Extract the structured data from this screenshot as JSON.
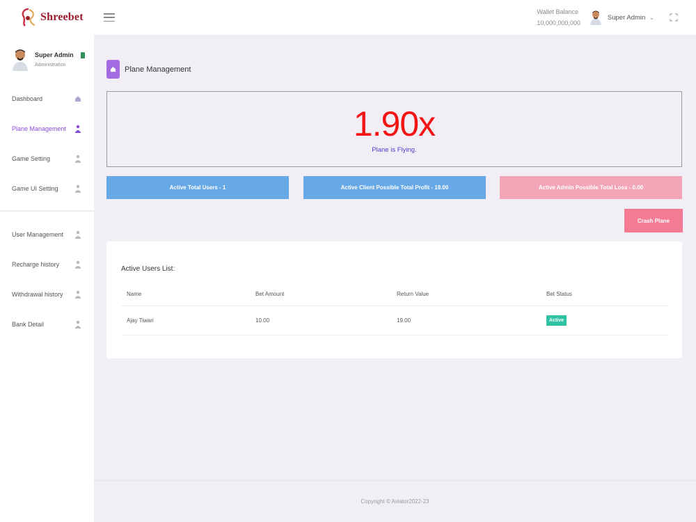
{
  "brand": {
    "name": "Shreebet",
    "accent": "#9c1b2d"
  },
  "header": {
    "menu_icon": "hamburger-icon",
    "wallet_label": "Wallet Balance",
    "wallet_value": "10,000,000,000",
    "user_name": "Super Admin",
    "user_menu_icon": "chevron-down-icon",
    "fullscreen_icon": "fullscreen-icon"
  },
  "sidebar": {
    "profile": {
      "name": "Super Admin",
      "role": "Administration"
    },
    "items": [
      {
        "label": "Dashboard",
        "icon": "home-icon",
        "active": false
      },
      {
        "label": "Plane Management",
        "icon": "user-icon",
        "active": true
      },
      {
        "label": "Game Setting",
        "icon": "user-icon",
        "active": false
      },
      {
        "label": "Game UI Setting",
        "icon": "user-icon",
        "active": false
      },
      {
        "label": "User Management",
        "icon": "user-icon",
        "active": false
      },
      {
        "label": "Recharge history",
        "icon": "user-icon",
        "active": false
      },
      {
        "label": "Withdrawal history",
        "icon": "user-icon",
        "active": false
      },
      {
        "label": "Bank Detail",
        "icon": "user-icon",
        "active": false
      }
    ]
  },
  "page": {
    "title": "Plane Management",
    "title_icon": "home-icon",
    "multiplier": "1.90x",
    "flight_status": "Plane is Flying.",
    "stats": {
      "active_users": "Active Total Users - 1",
      "client_profit": "Active Client Possible Total Profit - 19.00",
      "admin_loss": "Active Admin Possible Total Loss - 0.00"
    },
    "crash_button": "Crash Plane",
    "colors": {
      "multiplier": "#f31414",
      "status": "#4b3fd1",
      "stat_blue": "#67a9e6",
      "stat_pink": "#f4a6b9",
      "crash": "#f57a94",
      "badge": "#2ec4a3"
    }
  },
  "active_users": {
    "title": "Active Users List:",
    "columns": {
      "name": "Name",
      "bet": "Bet Amount",
      "return": "Return Value",
      "status": "Bet Status"
    },
    "rows": [
      {
        "name": "Ajay Tiwari",
        "bet": "10.00",
        "return": "19.00",
        "status": "Active"
      }
    ]
  },
  "footer": {
    "text": "Copyright © Aviator2022-23"
  }
}
